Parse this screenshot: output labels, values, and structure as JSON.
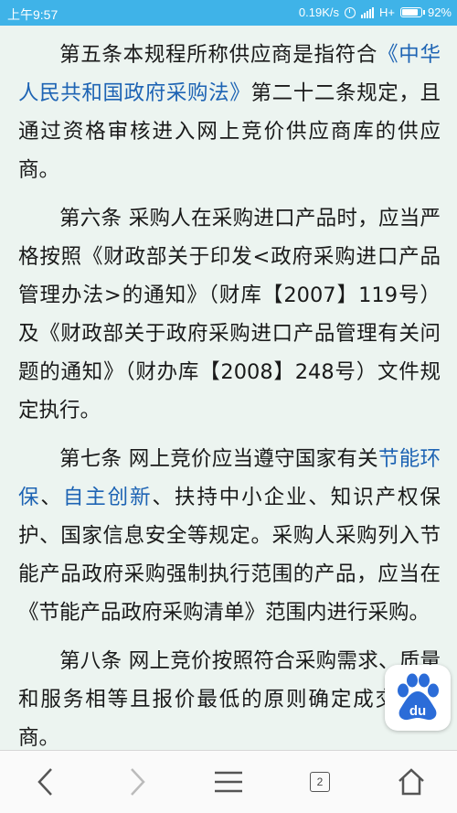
{
  "status_bar": {
    "time": "上午9:57",
    "network_speed": "0.19K/s",
    "network_type": "H+",
    "battery": "92%",
    "battery_level": 0.92,
    "icons": [
      "alarm-icon",
      "signal-icon",
      "battery-icon"
    ]
  },
  "article": {
    "p1": {
      "text_a": "第五条本规程所称供应商是指符合",
      "link": "《中华人民共和国政府采购法》",
      "text_b": "第二十二条规定，且通过资格审核进入网上竞价供应商库的供应商。"
    },
    "p2": {
      "text": "第六条 采购人在采购进口产品时，应当严格按照《财政部关于印发<政府采购进口产品管理办法>的通知》（财库【2007】119号）及《财政部关于政府采购进口产品管理有关问题的通知》（财办库【2008】248号）文件规定执行。"
    },
    "p3": {
      "text_a": "第七条 网上竞价应当遵守国家有关",
      "link1": "节能环保",
      "sep": "、",
      "link2": "自主创新",
      "text_b": "、扶持中小企业、知识产权保护、国家信息安全等规定。采购人采购列入节能产品政府采购强制执行范围的产品，应当在《节能产品政府采购清单》范围内进行采购。"
    },
    "p4": {
      "text": "第八条 网上竞价按照符合采购需求、质量和服务相等且报价最低的原则确定成交供应商。"
    }
  },
  "baidu_badge": {
    "label": "du",
    "icon": "baidu-paw-icon"
  },
  "bottom_nav": {
    "tab_count": "2",
    "icons": [
      "back-icon",
      "forward-icon",
      "menu-icon",
      "tabs-icon",
      "home-icon"
    ]
  },
  "colors": {
    "status_bar": "#3fb3e8",
    "background": "#ecf4f0",
    "link": "#1e64b4",
    "baidu_blue": "#2b6cd8"
  }
}
